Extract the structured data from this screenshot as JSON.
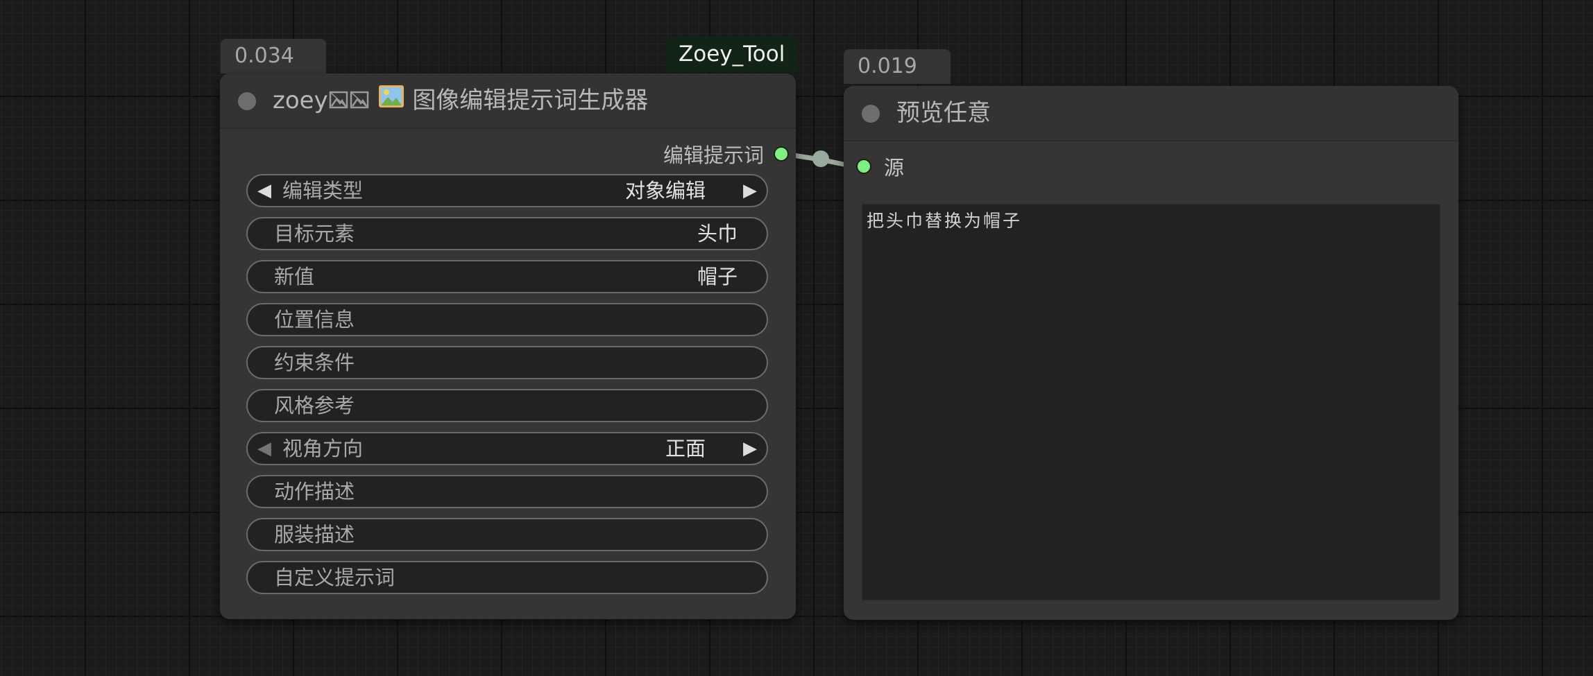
{
  "left_node": {
    "exec_time": "0.034秒",
    "title_prefix": "zoey",
    "title_text": "图像编辑提示词生成器",
    "output_label": "编辑提示词",
    "widgets": [
      {
        "label": "编辑类型",
        "value": "对象编辑"
      },
      {
        "label": "目标元素",
        "value": "头巾"
      },
      {
        "label": "新值",
        "value": "帽子"
      },
      {
        "label": "位置信息",
        "value": ""
      },
      {
        "label": "约束条件",
        "value": ""
      },
      {
        "label": "风格参考",
        "value": ""
      },
      {
        "label": "视角方向",
        "value": "正面"
      },
      {
        "label": "动作描述",
        "value": ""
      },
      {
        "label": "服装描述",
        "value": ""
      },
      {
        "label": "自定义提示词",
        "value": ""
      }
    ]
  },
  "group_label": "Zoey_Tool",
  "right_node": {
    "exec_time": "0.019秒",
    "title": "预览任意",
    "input_label": "源",
    "preview_text": "把头巾替换为帽子"
  },
  "icons": {
    "title_dot": "status-dot-icon",
    "broken_image": "broken-image-icon",
    "picture": "picture-icon",
    "arrow_left": "arrow-left-icon",
    "arrow_right": "arrow-right-icon"
  },
  "colors": {
    "slot_active": "#7ef07e",
    "link": "#9aaa9a",
    "group_tag_bg": "#122416"
  }
}
